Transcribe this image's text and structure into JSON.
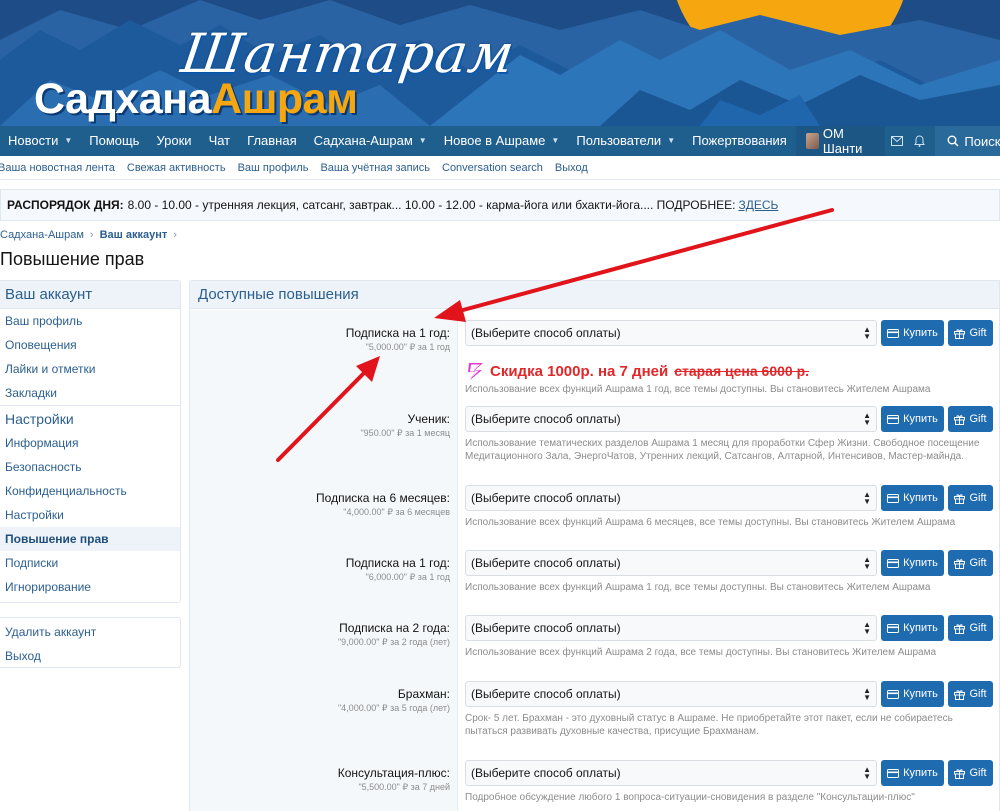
{
  "banner": {
    "logo_script": "Шантарам",
    "logo_white": "Садхана",
    "logo_yellow": "Ашрам",
    "colors": {
      "sky": "#1f4f8a",
      "mountain": "#2a6fb0",
      "sun": "#f6a60f"
    }
  },
  "nav": {
    "items": [
      {
        "label": "Новости",
        "dropdown": true
      },
      {
        "label": "Помощь",
        "dropdown": false
      },
      {
        "label": "Уроки",
        "dropdown": false
      },
      {
        "label": "Чат",
        "dropdown": false
      },
      {
        "label": "Главная",
        "dropdown": false
      },
      {
        "label": "Садхана-Ашрам",
        "dropdown": true
      },
      {
        "label": "Новое в Ашраме",
        "dropdown": true
      },
      {
        "label": "Пользователи",
        "dropdown": true
      },
      {
        "label": "Пожертвования",
        "dropdown": false
      }
    ],
    "user_name": "ОМ Шанти",
    "search_label": "Поиск",
    "icons": {
      "inbox": "envelope-icon",
      "alerts": "bell-icon",
      "search": "search-icon"
    }
  },
  "subnav": {
    "links": [
      "Ваша новостная лента",
      "Свежая активность",
      "Ваш профиль",
      "Ваша учётная запись",
      "Conversation search",
      "Выход"
    ]
  },
  "notice": {
    "bold": "РАСПОРЯДОК ДНЯ:",
    "text": "8.00 - 10.00 - утренняя лекция, сатсанг, завтрак... 10.00 - 12.00 - карма-йога или бхакти-йога.... ПОДРОБНЕЕ:",
    "link": "ЗДЕСЬ"
  },
  "breadcrumb": {
    "items": [
      "Садхана-Ашрам",
      "Ваш аккаунт"
    ]
  },
  "page_title": "Повышение прав",
  "sidebar": {
    "account_header": "Ваш аккаунт",
    "account_links": [
      "Ваш профиль",
      "Оповещения",
      "Лайки и отметки",
      "Закладки"
    ],
    "settings_header": "Настройки",
    "settings_links": [
      "Информация",
      "Безопасность",
      "Конфиденциальность",
      "Настройки",
      "Повышение прав",
      "Подписки",
      "Игнорирование"
    ],
    "active": "Повышение прав",
    "bottom_links": [
      "Удалить аккаунт",
      "Выход"
    ]
  },
  "main": {
    "header": "Доступные повышения",
    "select_placeholder": "(Выберите способ оплаты)",
    "buy_label": "Купить",
    "gift_label": "Gift",
    "promo_text": "Скидка 1000р. на 7 дней",
    "promo_strike": "старая цена 6000 р.",
    "upgrades": [
      {
        "title": "Подписка на 1 год:",
        "cost": "\"5,000.00\" ₽ за 1 год",
        "desc": "Использование всех функций Ашрама 1 год, все темы доступны. Вы становитесь Жителем Ашрама"
      },
      {
        "title": "Ученик:",
        "cost": "\"950.00\" ₽ за 1 месяц",
        "desc": "Использование тематических разделов Ашрама 1 месяц для проработки Сфер Жизни. Свободное посещение Медитационного Зала, ЭнергоЧатов, Утренних лекций, Сатсангов, Алтарной, Интенсивов, Мастер-майнда."
      },
      {
        "title": "Подписка на 6 месяцев:",
        "cost": "\"4,000.00\" ₽ за 6 месяцев",
        "desc": "Использование всех функций Ашрама 6 месяцев, все темы доступны. Вы становитесь Жителем Ашрама"
      },
      {
        "title": "Подписка на 1 год:",
        "cost": "\"6,000.00\" ₽ за 1 год",
        "desc": "Использование всех функций Ашрама 1 год, все темы доступны. Вы становитесь Жителем Ашрама"
      },
      {
        "title": "Подписка на 2 года:",
        "cost": "\"9,000.00\" ₽ за 2 года (лет)",
        "desc": "Использование всех функций Ашрама 2 года, все темы доступны. Вы становитесь Жителем Ашрама"
      },
      {
        "title": "Брахман:",
        "cost": "\"4,000.00\" ₽ за 5 года (лет)",
        "desc": "Срок- 5 лет. Брахман - это духовный статус в Ашраме. Не приобретайте этот пакет, если не собираетесь пытаться развивать духовные качества, присущие Брахманам."
      },
      {
        "title": "Консультация-плюс:",
        "cost": "\"5,500.00\" ₽ за 7 дней",
        "desc": "Подробное обсуждение любого 1 вопроса-ситуации-сновидения в разделе \"Консультации-плюс\""
      }
    ]
  }
}
